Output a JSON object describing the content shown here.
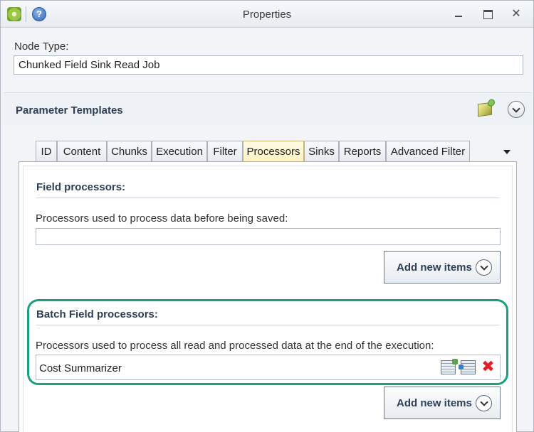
{
  "window": {
    "title": "Properties",
    "help_glyph": "?",
    "close_glyph": "✕"
  },
  "node_type": {
    "label": "Node Type:",
    "value": "Chunked Field Sink Read Job"
  },
  "parameter_templates": {
    "title": "Parameter Templates"
  },
  "tabs": [
    {
      "label": "ID",
      "active": false
    },
    {
      "label": "Content",
      "active": false
    },
    {
      "label": "Chunks",
      "active": false
    },
    {
      "label": "Execution",
      "active": false
    },
    {
      "label": "Filter",
      "active": false
    },
    {
      "label": "Processors",
      "active": true
    },
    {
      "label": "Sinks",
      "active": false
    },
    {
      "label": "Reports",
      "active": false
    },
    {
      "label": "Advanced Filter",
      "active": false
    }
  ],
  "field_processors": {
    "title": "Field processors:",
    "description": "Processors used to process data before being saved:",
    "items": [],
    "add_label": "Add new items"
  },
  "batch_field_processors": {
    "title": "Batch Field processors:",
    "description": "Processors used to process all read and processed data at the end of the execution:",
    "items": [
      "Cost Summarizer"
    ],
    "add_label": "Add new items",
    "delete_glyph": "✖"
  },
  "colors": {
    "highlight": "#1aa07f",
    "active_tab": "#fff1c2",
    "section_title": "#2d3e55"
  }
}
